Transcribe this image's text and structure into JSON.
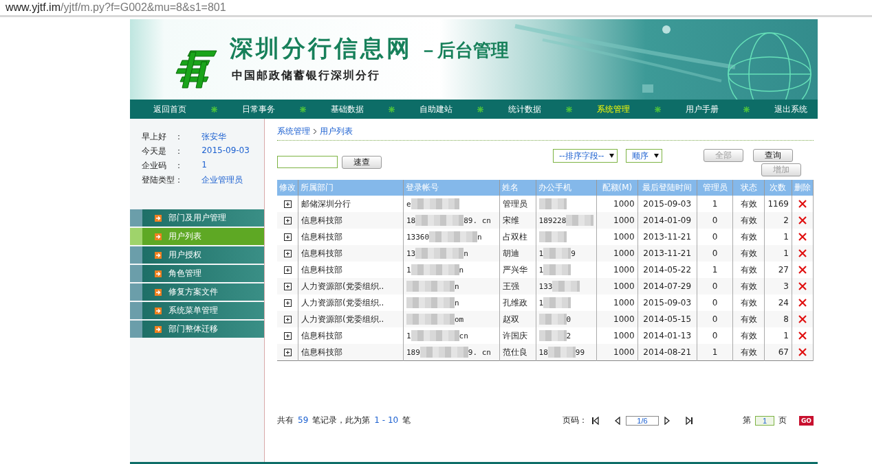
{
  "address_bar": {
    "host": "www.yjtf.im",
    "path": "/yjtf/m.py?f=G002&mu=8&s1=801"
  },
  "banner": {
    "title": "深圳分行信息网",
    "title_suffix": "－后台管理",
    "subtitle": "中国邮政储蓄银行深圳分行"
  },
  "nav": [
    {
      "label": "返回首页",
      "selected": false
    },
    {
      "label": "日常事务",
      "selected": false
    },
    {
      "label": "基础数据",
      "selected": false
    },
    {
      "label": "自助建站",
      "selected": false
    },
    {
      "label": "统计数据",
      "selected": false
    },
    {
      "label": "系统管理",
      "selected": true
    },
    {
      "label": "用户手册",
      "selected": false
    },
    {
      "label": "退出系统",
      "selected": false
    }
  ],
  "user_info": [
    {
      "label": "早上好　：",
      "value": "张安华"
    },
    {
      "label": "今天是　：",
      "value": "2015-09-03"
    },
    {
      "label": "企业码　：",
      "value": "1"
    },
    {
      "label": "登陆类型：",
      "value": "企业管理员"
    }
  ],
  "sidebar": {
    "items": [
      {
        "label": "部门及用户管理",
        "selected": false
      },
      {
        "label": "用户列表",
        "selected": true
      },
      {
        "label": "用户授权",
        "selected": false
      },
      {
        "label": "角色管理",
        "selected": false
      },
      {
        "label": "修复方案文件",
        "selected": false
      },
      {
        "label": "系统菜单管理",
        "selected": false
      },
      {
        "label": "部门整体迁移",
        "selected": false
      }
    ]
  },
  "breadcrumb": [
    "系统管理",
    "用户列表"
  ],
  "toolbar": {
    "quick_search_button": "速查",
    "sort_field": "--排序字段--",
    "sort_order": "顺序",
    "buttons": [
      {
        "label": "全部",
        "disabled": true
      },
      {
        "label": "查询",
        "disabled": false
      },
      {
        "label": "增加",
        "disabled": true
      }
    ]
  },
  "table": {
    "columns": [
      "修改",
      "所属部门",
      "登录帐号",
      "姓名",
      "办公手机",
      "配额(M)",
      "最后登陆时间",
      "管理员",
      "状态",
      "次数",
      "删除"
    ],
    "rows": [
      {
        "department": "邮储深圳分行",
        "account": {
          "start": "e"
        },
        "name": "管理员",
        "phone": {},
        "quota": "1000",
        "last_login": "2015-09-03",
        "admin": "1",
        "status": "有效",
        "count": "1169"
      },
      {
        "department": "信息科技部",
        "account": {
          "start": "18",
          "end": "89. cn"
        },
        "name": "宋维",
        "phone": {
          "start": "189228"
        },
        "quota": "1000",
        "last_login": "2014-01-09",
        "admin": "0",
        "status": "有效",
        "count": "2"
      },
      {
        "department": "信息科技部",
        "account": {
          "start": "13360",
          "end": "n"
        },
        "name": "占双柱",
        "phone": {},
        "quota": "1000",
        "last_login": "2013-11-21",
        "admin": "0",
        "status": "有效",
        "count": "1"
      },
      {
        "department": "信息科技部",
        "account": {
          "start": "13",
          "end": "n"
        },
        "name": "胡迪",
        "phone": {
          "start": "1",
          "end": "9"
        },
        "quota": "1000",
        "last_login": "2013-11-21",
        "admin": "0",
        "status": "有效",
        "count": "1"
      },
      {
        "department": "信息科技部",
        "account": {
          "start": "1",
          "end": "n"
        },
        "name": "严兴华",
        "phone": {
          "start": "1"
        },
        "quota": "1000",
        "last_login": "2014-05-22",
        "admin": "1",
        "status": "有效",
        "count": "27"
      },
      {
        "department": "人力资源部(党委组织..",
        "account": {
          "end": "n"
        },
        "name": "王强",
        "phone": {
          "start": "133"
        },
        "quota": "1000",
        "last_login": "2014-07-29",
        "admin": "0",
        "status": "有效",
        "count": "3"
      },
      {
        "department": "人力资源部(党委组织..",
        "account": {
          "end": "n"
        },
        "name": "孔维政",
        "phone": {
          "start": "1"
        },
        "quota": "1000",
        "last_login": "2015-09-03",
        "admin": "0",
        "status": "有效",
        "count": "24"
      },
      {
        "department": "人力资源部(党委组织..",
        "account": {
          "end": "om"
        },
        "name": "赵双",
        "phone": {
          "end": "0"
        },
        "quota": "1000",
        "last_login": "2014-05-15",
        "admin": "0",
        "status": "有效",
        "count": "8"
      },
      {
        "department": "信息科技部",
        "account": {
          "start": "1",
          "end": "cn"
        },
        "name": "许国庆",
        "phone": {
          "end": "2"
        },
        "quota": "1000",
        "last_login": "2014-01-13",
        "admin": "0",
        "status": "有效",
        "count": "1"
      },
      {
        "department": "信息科技部",
        "account": {
          "start": "189",
          "end": "9. cn"
        },
        "name": "范仕良",
        "phone": {
          "start": "18",
          "end": "99"
        },
        "quota": "1000",
        "last_login": "2014-08-21",
        "admin": "1",
        "status": "有效",
        "count": "67"
      }
    ]
  },
  "footer": {
    "summary": [
      {
        "text": "共有",
        "highlight": false
      },
      {
        "text": "59",
        "highlight": true
      },
      {
        "text": "笔记录，此为第",
        "highlight": false
      },
      {
        "text": "1 - 10",
        "highlight": true
      },
      {
        "text": "笔",
        "highlight": false
      }
    ],
    "pager_label": "页码：",
    "page_field": "1/6",
    "page_prefix": "第",
    "page_input": "1",
    "page_suffix": "页",
    "go_button": "GO"
  }
}
